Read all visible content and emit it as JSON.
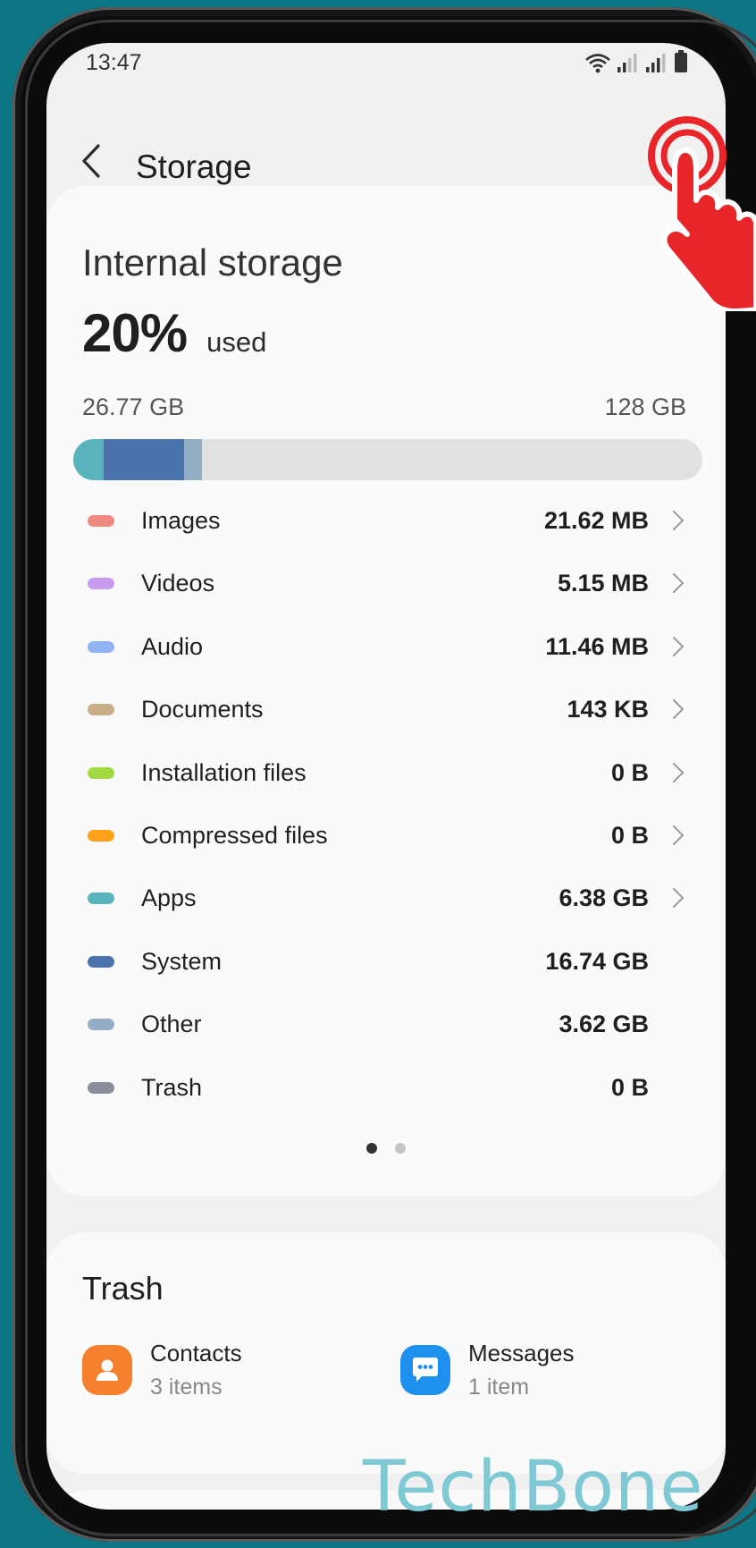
{
  "status_bar": {
    "time": "13:47"
  },
  "app_bar": {
    "title": "Storage"
  },
  "storage": {
    "heading": "Internal storage",
    "percent_used": "20%",
    "used_word": "used",
    "used_size": "26.77 GB",
    "total_size": "128 GB",
    "bar_fill_fraction": 0.21
  },
  "categories": [
    {
      "name": "Images",
      "size": "21.62 MB",
      "color": "#ef8a80",
      "chevron": true
    },
    {
      "name": "Videos",
      "size": "5.15 MB",
      "color": "#c69bef",
      "chevron": true
    },
    {
      "name": "Audio",
      "size": "11.46 MB",
      "color": "#8fb3f5",
      "chevron": true
    },
    {
      "name": "Documents",
      "size": "143 KB",
      "color": "#c8ae86",
      "chevron": true
    },
    {
      "name": "Installation files",
      "size": "0 B",
      "color": "#a2d840",
      "chevron": true
    },
    {
      "name": "Compressed files",
      "size": "0 B",
      "color": "#ffa21a",
      "chevron": true
    },
    {
      "name": "Apps",
      "size": "6.38 GB",
      "color": "#58b3bd",
      "chevron": true
    },
    {
      "name": "System",
      "size": "16.74 GB",
      "color": "#4a72ad",
      "chevron": false
    },
    {
      "name": "Other",
      "size": "3.62 GB",
      "color": "#93aec4",
      "chevron": false
    },
    {
      "name": "Trash",
      "size": "0 B",
      "color": "#8a8f99",
      "chevron": false
    }
  ],
  "pager": {
    "pages": 2,
    "current": 1,
    "active_color": "#333333",
    "inactive_color": "#c4c4c4"
  },
  "trash": {
    "title": "Trash",
    "items": [
      {
        "name": "Contacts",
        "count": "3 items",
        "icon": "contacts-icon",
        "color": "#f57f2d"
      },
      {
        "name": "Messages",
        "count": "1 item",
        "icon": "messages-icon",
        "color": "#1e90ee"
      }
    ]
  },
  "watermark": "TechBone",
  "colors": {
    "background_teal": "#0e7585",
    "tap_indicator_red": "#e8262a"
  }
}
